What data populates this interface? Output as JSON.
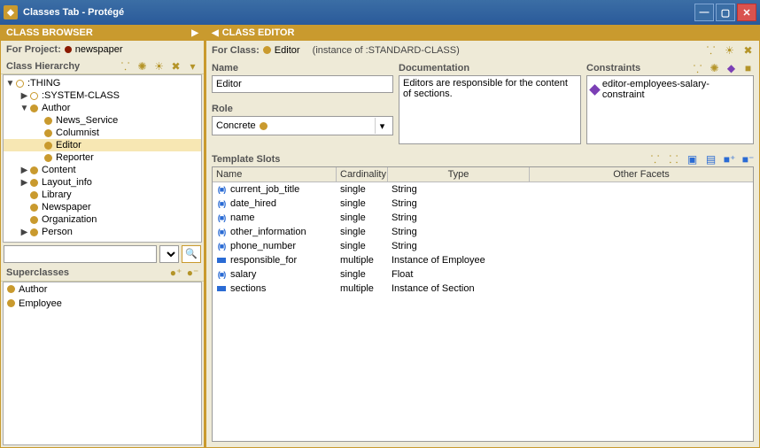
{
  "window": {
    "title": "Classes Tab - Protégé"
  },
  "browser": {
    "header": "CLASS BROWSER",
    "for_project_label": "For Project:",
    "project_name": "newspaper",
    "hierarchy_label": "Class Hierarchy",
    "tree": [
      {
        "label": ":THING",
        "depth": 0,
        "expander": "▼",
        "iconType": "ring"
      },
      {
        "label": ":SYSTEM-CLASS",
        "depth": 1,
        "expander": "▶",
        "iconType": "ring"
      },
      {
        "label": "Author",
        "depth": 1,
        "expander": "▼",
        "iconType": "dot"
      },
      {
        "label": "News_Service",
        "depth": 2,
        "expander": "",
        "iconType": "dot"
      },
      {
        "label": "Columnist",
        "depth": 2,
        "expander": "",
        "iconType": "dot"
      },
      {
        "label": "Editor",
        "depth": 2,
        "expander": "",
        "iconType": "dot",
        "selected": true
      },
      {
        "label": "Reporter",
        "depth": 2,
        "expander": "",
        "iconType": "dot"
      },
      {
        "label": "Content",
        "depth": 1,
        "expander": "▶",
        "iconType": "dot"
      },
      {
        "label": "Layout_info",
        "depth": 1,
        "expander": "▶",
        "iconType": "dot"
      },
      {
        "label": "Library",
        "depth": 1,
        "expander": "",
        "iconType": "dot"
      },
      {
        "label": "Newspaper",
        "depth": 1,
        "expander": "",
        "iconType": "dot"
      },
      {
        "label": "Organization",
        "depth": 1,
        "expander": "",
        "iconType": "dot"
      },
      {
        "label": "Person",
        "depth": 1,
        "expander": "▶",
        "iconType": "dot"
      }
    ],
    "super_label": "Superclasses",
    "superclasses": [
      "Author",
      "Employee"
    ]
  },
  "editor": {
    "header": "CLASS EDITOR",
    "for_class_label": "For Class:",
    "class_name": "Editor",
    "instance_of": "(instance of :STANDARD-CLASS)",
    "name_label": "Name",
    "name_value": "Editor",
    "role_label": "Role",
    "role_value": "Concrete",
    "doc_label": "Documentation",
    "doc_value": "Editors are responsible for the content of sections.",
    "cons_label": "Constraints",
    "constraints": [
      "editor-employees-salary-constraint"
    ],
    "slots_label": "Template Slots",
    "columns": {
      "name": "Name",
      "card": "Cardinality",
      "type": "Type",
      "other": "Other Facets"
    },
    "slots": [
      {
        "name": "current_job_title",
        "card": "single",
        "type": "String",
        "inherited": true
      },
      {
        "name": "date_hired",
        "card": "single",
        "type": "String",
        "inherited": true
      },
      {
        "name": "name",
        "card": "single",
        "type": "String",
        "inherited": true
      },
      {
        "name": "other_information",
        "card": "single",
        "type": "String",
        "inherited": true
      },
      {
        "name": "phone_number",
        "card": "single",
        "type": "String",
        "inherited": true
      },
      {
        "name": "responsible_for",
        "card": "multiple",
        "type": "Instance of Employee",
        "inherited": false
      },
      {
        "name": "salary",
        "card": "single",
        "type": "Float",
        "inherited": true
      },
      {
        "name": "sections",
        "card": "multiple",
        "type": "Instance of Section",
        "inherited": false
      }
    ]
  }
}
